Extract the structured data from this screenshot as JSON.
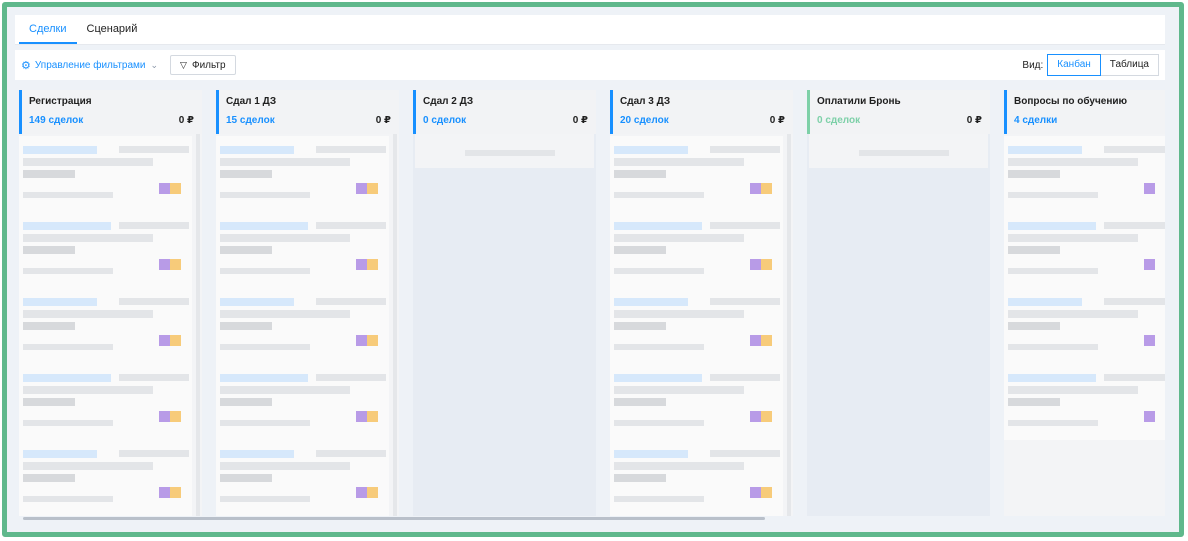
{
  "tabs": [
    {
      "label": "Сделки",
      "active": true
    },
    {
      "label": "Сценарий",
      "active": false
    }
  ],
  "toolbar": {
    "filter_manager_label": "Управление фильтрами",
    "filter_button_label": "Фильтр",
    "view_label": "Вид:",
    "views": [
      {
        "label": "Канбан",
        "active": true
      },
      {
        "label": "Таблица",
        "active": false
      }
    ]
  },
  "columns": [
    {
      "title": "Регистрация",
      "count": "149 сделок",
      "sum": "0 ₽",
      "accent": "#1890ff",
      "cards": 5
    },
    {
      "title": "Сдал 1 ДЗ",
      "count": "15 сделок",
      "sum": "0 ₽",
      "accent": "#1890ff",
      "cards": 5
    },
    {
      "title": "Сдал 2 ДЗ",
      "count": "0 сделок",
      "sum": "0 ₽",
      "accent": "#1890ff",
      "cards": 0
    },
    {
      "title": "Сдал 3 ДЗ",
      "count": "20 сделок",
      "sum": "0 ₽",
      "accent": "#1890ff",
      "cards": 5
    },
    {
      "title": "Оплатили Бронь",
      "count": "0 сделок",
      "sum": "0 ₽",
      "accent": "#7dd0a8",
      "cards": 0
    },
    {
      "title": "Вопросы по обучению",
      "count": "4 сделки",
      "sum": "",
      "accent": "#1890ff",
      "cards": 4
    }
  ],
  "colors": {
    "accent": "#1890ff",
    "frame": "#5fb88c",
    "tag_purple": "#a27be0",
    "tag_orange": "#f6bf5a"
  }
}
